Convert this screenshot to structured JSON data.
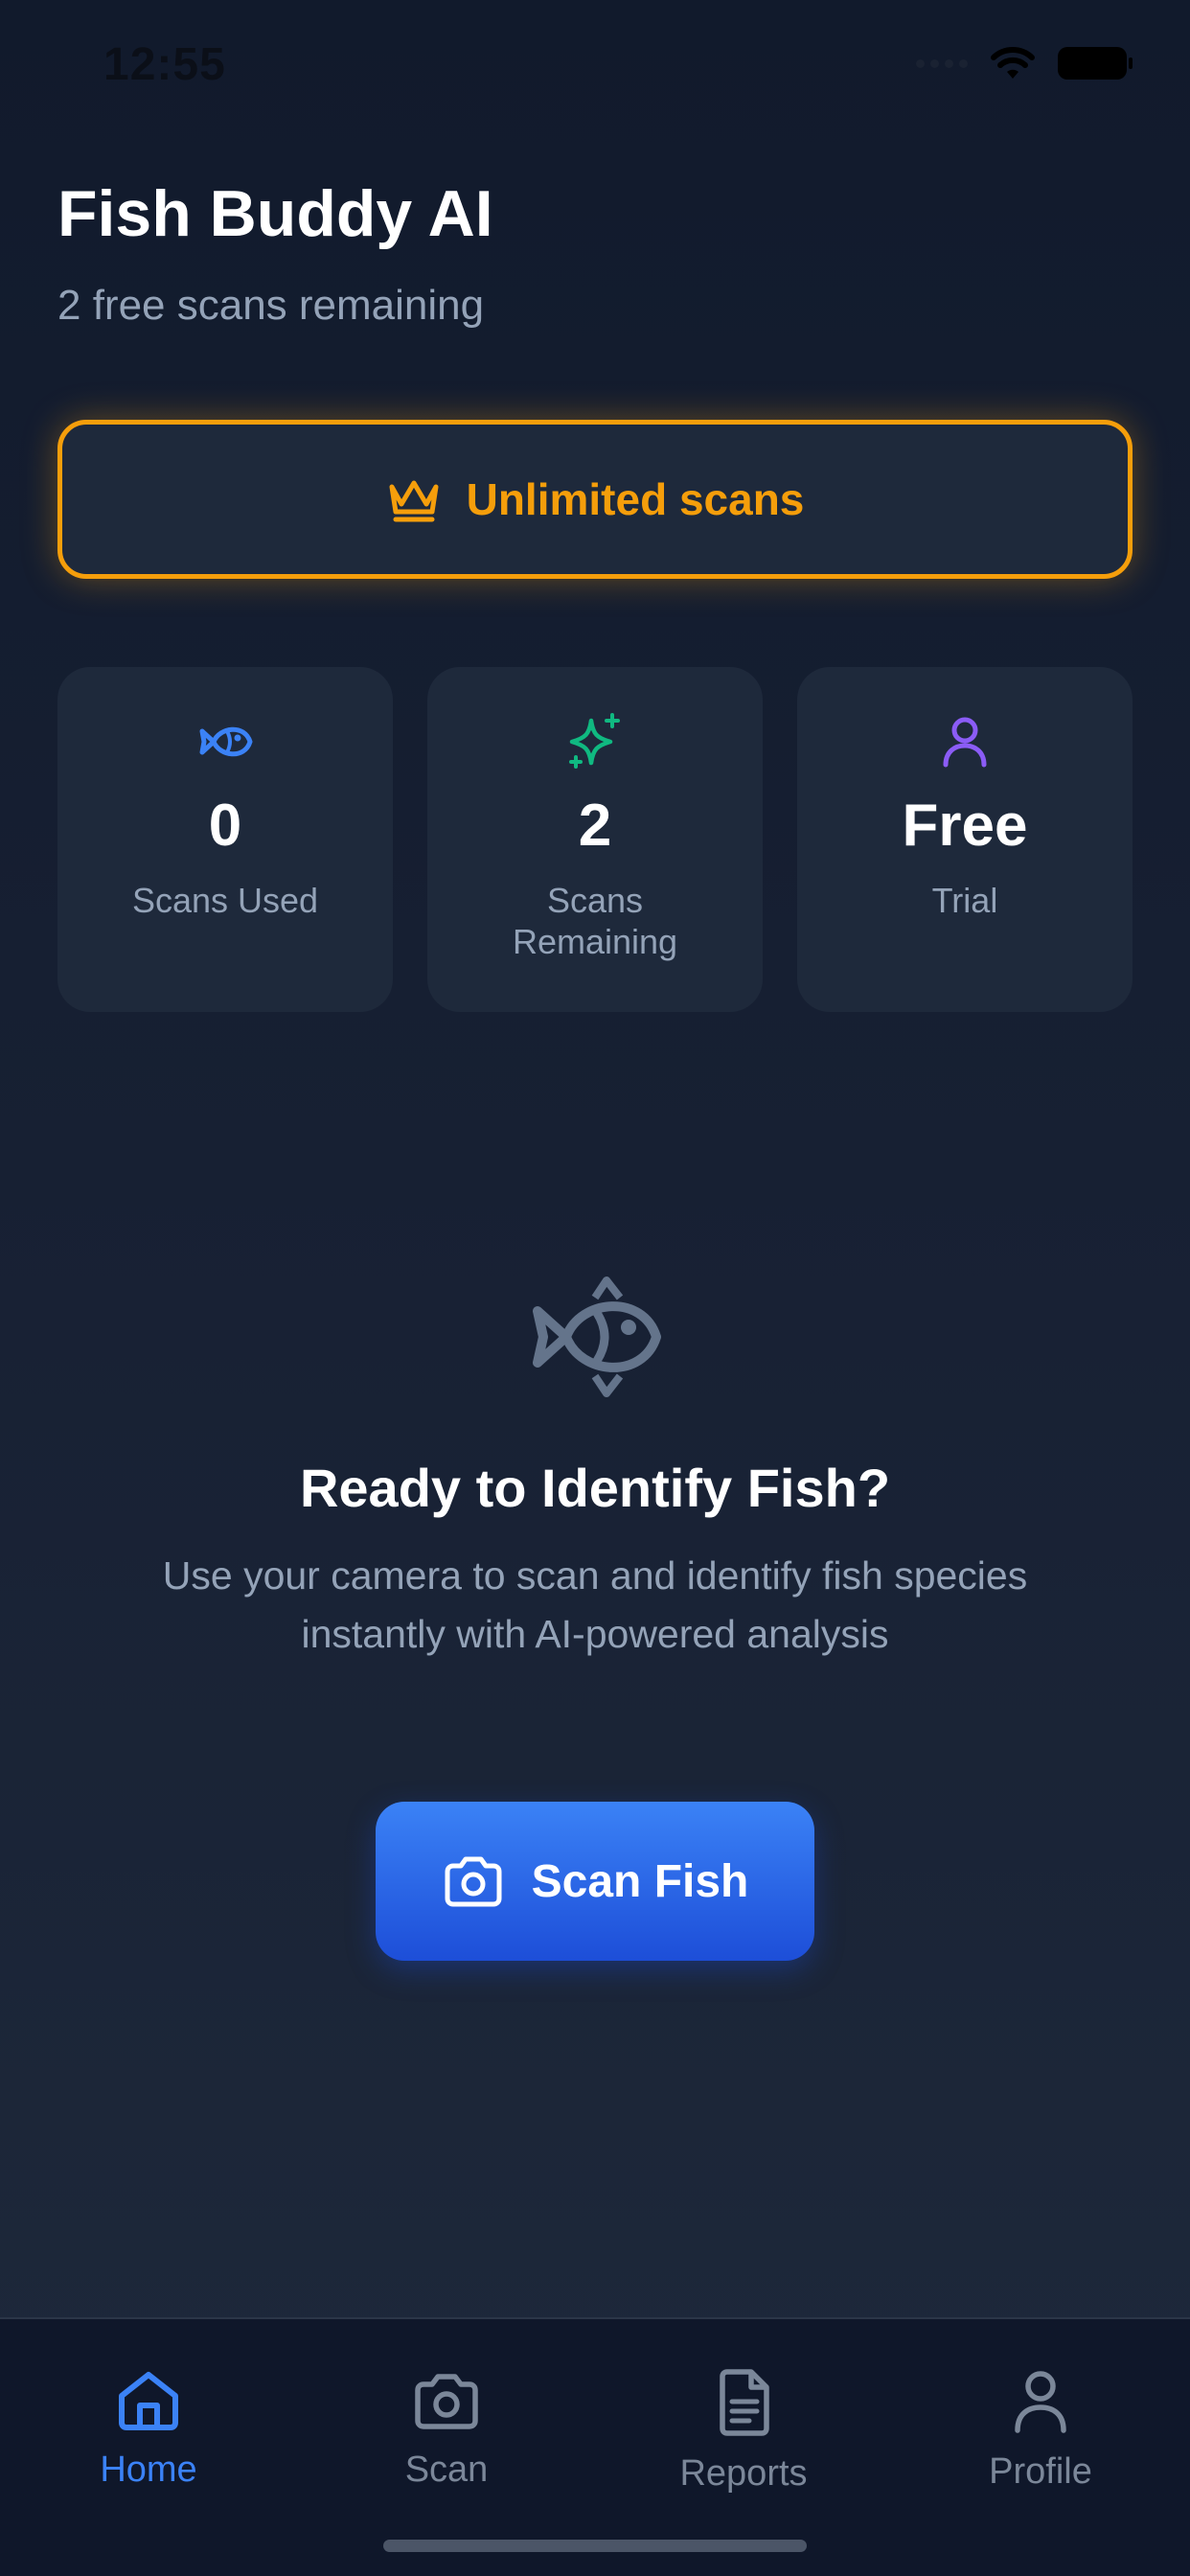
{
  "status_bar": {
    "time": "12:55"
  },
  "header": {
    "title": "Fish Buddy AI",
    "subtitle": "2 free scans remaining"
  },
  "premium": {
    "label": "Unlimited scans",
    "icon": "crown-icon",
    "color": "#f59e0b"
  },
  "stats": [
    {
      "value": "0",
      "label": "Scans Used",
      "icon": "fish-icon",
      "color": "#3b82f6"
    },
    {
      "value": "2",
      "label": "Scans Remaining",
      "icon": "sparkles-icon",
      "color": "#10b981"
    },
    {
      "value": "Free",
      "label": "Trial",
      "icon": "user-icon",
      "color": "#8b5cf6"
    }
  ],
  "hero": {
    "icon": "fish-icon",
    "title": "Ready to Identify Fish?",
    "description": "Use your camera to scan and identify fish species instantly with AI-powered analysis"
  },
  "scan_button": {
    "label": "Scan Fish",
    "icon": "camera-icon"
  },
  "tabs": [
    {
      "label": "Home",
      "icon": "home-icon",
      "active": true
    },
    {
      "label": "Scan",
      "icon": "camera-icon",
      "active": false
    },
    {
      "label": "Reports",
      "icon": "document-icon",
      "active": false
    },
    {
      "label": "Profile",
      "icon": "user-icon",
      "active": false
    }
  ],
  "colors": {
    "background": "#111a2c",
    "card": "#1e293b",
    "accent": "#3b82f6",
    "premium": "#f59e0b",
    "muted_text": "#94a3b8",
    "tab_inactive": "#7b8799"
  }
}
